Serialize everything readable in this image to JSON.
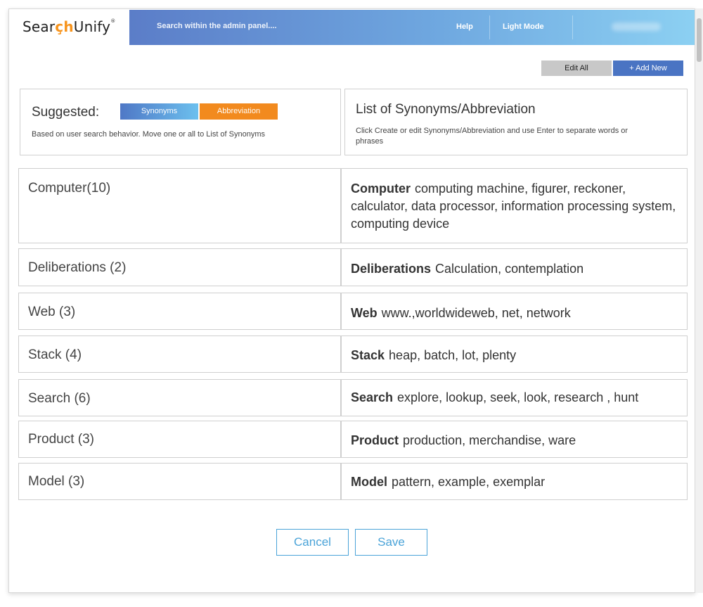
{
  "brand": {
    "logo_pre": "Sear",
    "logo_accent": "çh",
    "logo_post": "Unify",
    "logo_mark": "®",
    "accent_color": "#f7941d"
  },
  "topbar": {
    "search_placeholder": "Search within the admin panel....",
    "help_label": "Help",
    "mode_label": "Light Mode"
  },
  "actions": {
    "edit_all_label": "Edit All",
    "add_new_label": "+ Add New"
  },
  "suggested": {
    "title": "Suggested:",
    "tab_synonyms": "Synonyms",
    "tab_abbreviation": "Abbreviation",
    "description": "Based on user search behavior. Move one or all to List of Synonyms"
  },
  "list_panel": {
    "title": "List of Synonyms/Abbreviation",
    "description": "Click Create or edit Synonyms/Abbreviation and use Enter to separate words or phrases"
  },
  "rows": [
    {
      "term": "Computer(10)",
      "word": "Computer",
      "synonyms": "computing machine, figurer, reckoner, calculator, data processor, information processing system, computing device"
    },
    {
      "term": "Deliberations (2)",
      "word": "Deliberations",
      "synonyms": "Calculation, contemplation"
    },
    {
      "term": "Web (3)",
      "word": "Web",
      "synonyms": "www.,worldwideweb, net, network"
    },
    {
      "term": "Stack (4)",
      "word": "Stack",
      "synonyms": "heap, batch, lot, plenty"
    },
    {
      "term": "Search (6)",
      "word": "Search",
      "synonyms": "explore, lookup, seek, look, research , hunt"
    },
    {
      "term": "Product (3)",
      "word": "Product",
      "synonyms": "production, merchandise, ware"
    },
    {
      "term": "Model (3)",
      "word": "Model",
      "synonyms": "pattern, example, exemplar"
    }
  ],
  "footer": {
    "cancel_label": "Cancel",
    "save_label": "Save"
  }
}
